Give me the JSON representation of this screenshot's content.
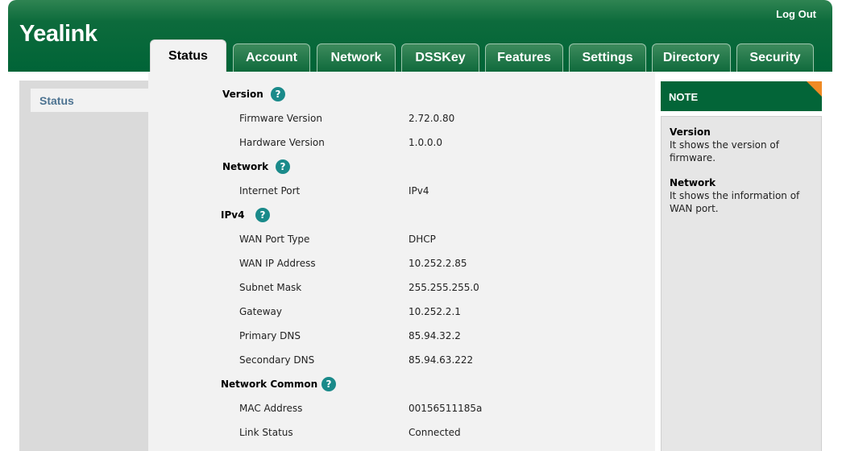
{
  "app": {
    "logo": "Yealink",
    "logout": "Log Out"
  },
  "tabs": [
    {
      "label": "Status",
      "active": true
    },
    {
      "label": "Account",
      "active": false
    },
    {
      "label": "Network",
      "active": false
    },
    {
      "label": "DSSKey",
      "active": false
    },
    {
      "label": "Features",
      "active": false
    },
    {
      "label": "Settings",
      "active": false
    },
    {
      "label": "Directory",
      "active": false
    },
    {
      "label": "Security",
      "active": false
    }
  ],
  "sidebar": {
    "items": [
      {
        "label": "Status"
      }
    ]
  },
  "help_symbol": "?",
  "main": {
    "version": {
      "title": "Version",
      "firmware_label": "Firmware Version",
      "firmware_value": "2.72.0.80",
      "hardware_label": "Hardware Version",
      "hardware_value": "1.0.0.0"
    },
    "network": {
      "title": "Network",
      "internet_port_label": "Internet Port",
      "internet_port_value": "IPv4"
    },
    "ipv4": {
      "title": "IPv4",
      "wan_type_label": "WAN Port Type",
      "wan_type_value": "DHCP",
      "wan_ip_label": "WAN IP Address",
      "wan_ip_value": "10.252.2.85",
      "subnet_label": "Subnet Mask",
      "subnet_value": "255.255.255.0",
      "gateway_label": "Gateway",
      "gateway_value": "10.252.2.1",
      "primary_dns_label": "Primary DNS",
      "primary_dns_value": "85.94.32.2",
      "secondary_dns_label": "Secondary DNS",
      "secondary_dns_value": "85.94.63.222"
    },
    "network_common": {
      "title": "Network Common",
      "mac_label": "MAC Address",
      "mac_value": "00156511185a",
      "link_label": "Link Status",
      "link_value": "Connected"
    }
  },
  "note": {
    "title": "NOTE",
    "items": [
      {
        "title": "Version",
        "text": "It shows the version of firmware."
      },
      {
        "title": "Network",
        "text": "It shows the information of WAN port."
      }
    ]
  },
  "colors": {
    "header_green": "#006437",
    "note_header": "#036538",
    "corner_orange": "#f08a24",
    "help_teal": "#1a8a8a"
  }
}
